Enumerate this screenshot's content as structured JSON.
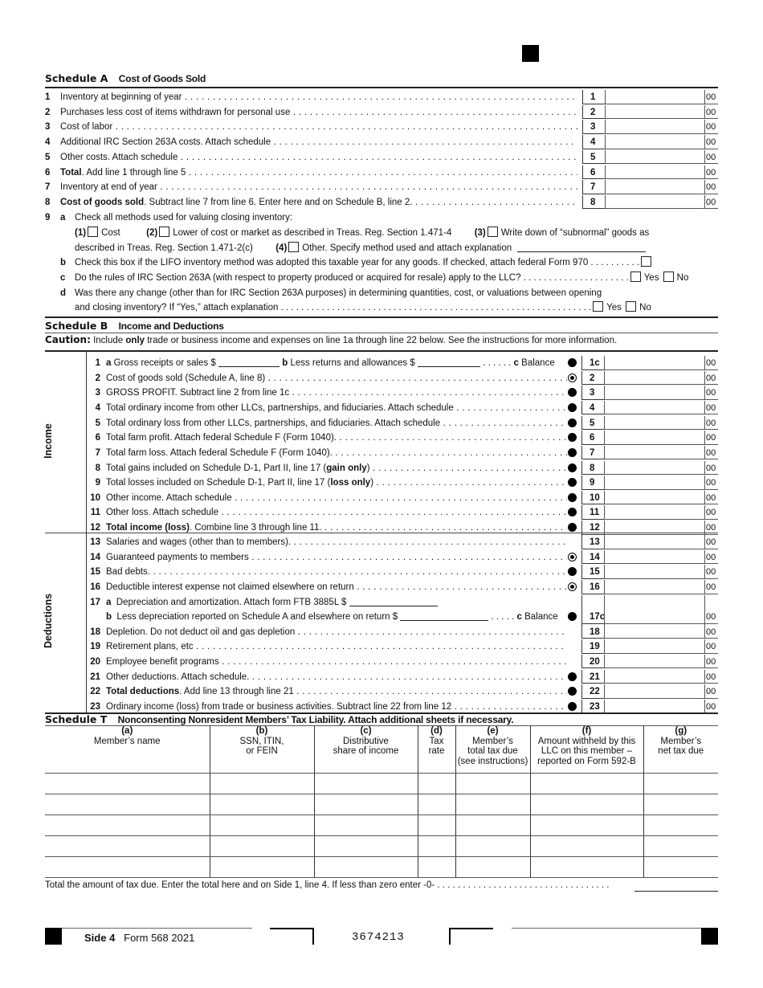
{
  "schedule_a": {
    "code": "Schedule A",
    "title": "Cost of Goods Sold",
    "lines": [
      {
        "num": "1",
        "desc": "Inventory at beginning of year",
        "box": "1",
        "cents": "00"
      },
      {
        "num": "2",
        "desc": "Purchases less cost of items withdrawn for personal use",
        "box": "2",
        "cents": "00"
      },
      {
        "num": "3",
        "desc": "Cost of labor",
        "box": "3",
        "cents": "00"
      },
      {
        "num": "4",
        "desc": "Additional IRC Section 263A costs. Attach schedule",
        "box": "4",
        "cents": "00"
      },
      {
        "num": "5",
        "desc": "Other costs. Attach schedule",
        "box": "5",
        "cents": "00"
      },
      {
        "num": "6",
        "desc_bold": "Total",
        "desc": ". Add line 1 through line 5",
        "box": "6",
        "cents": "00"
      },
      {
        "num": "7",
        "desc": "Inventory at end of year",
        "box": "7",
        "cents": "00"
      },
      {
        "num": "8",
        "desc_bold": "Cost of goods sold",
        "desc": ". Subtract line 7 from line 6. Enter here and on Schedule B, line 2.",
        "box": "8",
        "cents": "00"
      }
    ],
    "line9": {
      "num": "9",
      "a_letter": "a",
      "a_text": "Check all methods used for valuing closing inventory:",
      "opt1_num": "(1)",
      "opt1_label": "Cost",
      "opt2_num": "(2)",
      "opt2_label": "Lower of cost or market as described in Treas. Reg. Section 1.471-4",
      "opt3_num": "(3)",
      "opt3_label": "Write down of “subnormal” goods as",
      "opt3_cont": "described in Treas. Reg. Section 1.471-2(c)",
      "opt4_num": "(4)",
      "opt4_label": "Other. Specify method used and attach explanation",
      "b_letter": "b",
      "b_text": "Check this box if the LIFO inventory method was adopted this taxable year for any goods. If checked, attach federal Form 970 . . . . . . . . . .",
      "c_letter": "c",
      "c_text": "Do the rules of IRC Section 263A (with respect to property produced or acquired for resale) apply to the LLC? . . . . . . . . . . . . . . . . . . . . .",
      "d_letter": "d",
      "d_text": "Was there any change (other than for IRC Section 263A purposes) in determining quantities, cost, or valuations between opening",
      "d_cont": "and closing inventory? If “Yes,” attach explanation . . . . . . . . . . . . . . . . . . . . . . . . . . . . . . . . . . . . . . . . . . . . . . . . . . . . . . . . . . . . .",
      "yes": "Yes",
      "no": "No"
    }
  },
  "schedule_b": {
    "code": "Schedule B",
    "title": "Income and Deductions",
    "caution_label": "Caution:",
    "caution_pre": "Include",
    "caution_bold": "only",
    "caution_post": "trade or business income and expenses on line 1a through line 22 below. See the instructions for more information.",
    "income_label": "Income",
    "deductions_label": "Deductions",
    "line1": {
      "num": "1",
      "a": "a",
      "a_text": "Gross receipts or sales $",
      "b": "b",
      "b_text": "Less returns and allowances $",
      "dots": ". . . . . .",
      "c": "c",
      "c_text": "Balance",
      "box": "1c",
      "cents": "00"
    },
    "income_lines": [
      {
        "num": "2",
        "desc": "Cost of goods sold (Schedule A, line 8)",
        "box": "2",
        "cents": "00",
        "marker": "ring"
      },
      {
        "num": "3",
        "desc": "GROSS PROFIT. Subtract line 2 from line 1c",
        "box": "3",
        "cents": "00",
        "marker": "dot"
      },
      {
        "num": "4",
        "desc": "Total ordinary income from other LLCs, partnerships, and fiduciaries. Attach schedule",
        "box": "4",
        "cents": "00",
        "marker": "dot"
      },
      {
        "num": "5",
        "desc": "Total ordinary loss from other LLCs, partnerships, and fiduciaries. Attach schedule",
        "box": "5",
        "cents": "00",
        "marker": "dot"
      },
      {
        "num": "6",
        "desc": "Total farm profit. Attach federal Schedule F (Form 1040).",
        "box": "6",
        "cents": "00",
        "marker": "dot"
      },
      {
        "num": "7",
        "desc": "Total farm loss. Attach federal Schedule F (Form 1040).",
        "box": "7",
        "cents": "00",
        "marker": "dot"
      },
      {
        "num": "8",
        "desc": "Total gains included on Schedule D-1, Part II, line 17 (",
        "desc_bold": "gain only",
        "desc_end": ")",
        "box": "8",
        "cents": "00",
        "marker": "dot"
      },
      {
        "num": "9",
        "desc": "Total losses included on Schedule D-1, Part II, line 17 (",
        "desc_bold": "loss only",
        "desc_end": ")",
        "box": "9",
        "cents": "00",
        "marker": "dot"
      },
      {
        "num": "10",
        "desc": "Other income. Attach schedule",
        "box": "10",
        "cents": "00",
        "marker": "dot"
      },
      {
        "num": "11",
        "desc": "Other loss. Attach schedule",
        "box": "11",
        "cents": "00",
        "marker": "dot"
      },
      {
        "num": "12",
        "desc_lead_bold": "Total income (loss)",
        "desc": ". Combine line 3 through line 11.",
        "box": "12",
        "cents": "00",
        "marker": "dot"
      }
    ],
    "deduction_lines_a": [
      {
        "num": "13",
        "desc": "Salaries and wages (other than to members).",
        "box": "13",
        "cents": "00",
        "marker": "none"
      },
      {
        "num": "14",
        "desc": "Guaranteed payments to members",
        "box": "14",
        "cents": "00",
        "marker": "ring"
      },
      {
        "num": "15",
        "desc": "Bad debts.",
        "box": "15",
        "cents": "00",
        "marker": "dot"
      },
      {
        "num": "16",
        "desc": "Deductible interest expense not claimed elsewhere on return",
        "box": "16",
        "cents": "00",
        "marker": "ring"
      }
    ],
    "line17": {
      "num": "17",
      "a": "a",
      "a_text": "Depreciation and amortization. Attach form FTB 3885L $",
      "b": "b",
      "b_text": "Less depreciation reported on Schedule A and elsewhere on return $",
      "dots": ". . . . .",
      "c": "c",
      "c_text": "Balance",
      "box": "17c",
      "cents": "00"
    },
    "deduction_lines_b": [
      {
        "num": "18",
        "desc": "Depletion. Do not deduct oil and gas depletion",
        "box": "18",
        "cents": "00",
        "marker": "none"
      },
      {
        "num": "19",
        "desc": "Retirement plans, etc",
        "box": "19",
        "cents": "00",
        "marker": "none"
      },
      {
        "num": "20",
        "desc": "Employee benefit programs",
        "box": "20",
        "cents": "00",
        "marker": "none"
      },
      {
        "num": "21",
        "desc": "Other deductions. Attach schedule.",
        "box": "21",
        "cents": "00",
        "marker": "dot"
      },
      {
        "num": "22",
        "desc_lead_bold": "Total deductions",
        "desc": ". Add line 13 through line 21",
        "box": "22",
        "cents": "00",
        "marker": "dot"
      },
      {
        "num": "23",
        "desc": "Ordinary income (loss) from trade or business activities. Subtract line 22 from line 12",
        "box": "23",
        "cents": "00",
        "marker": "dot"
      }
    ]
  },
  "schedule_t": {
    "code": "Schedule T",
    "title": "Nonconsenting Nonresident Members’ Tax Liability. Attach additional sheets if necessary.",
    "columns": [
      {
        "letter": "(a)",
        "label": "Member’s name"
      },
      {
        "letter": "(b)",
        "label": "SSN, ITIN,\nor FEIN"
      },
      {
        "letter": "(c)",
        "label": "Distributive\nshare of income"
      },
      {
        "letter": "(d)",
        "label": "Tax\nrate"
      },
      {
        "letter": "(e)",
        "label": "Member’s\ntotal tax due\n(see instructions)"
      },
      {
        "letter": "(f)",
        "label": "Amount withheld by this\nLLC on this member –\nreported on Form 592-B"
      },
      {
        "letter": "(g)",
        "label": "Member’s\nnet tax due"
      }
    ],
    "rows": [
      [
        "",
        "",
        "",
        "",
        "",
        "",
        ""
      ],
      [
        "",
        "",
        "",
        "",
        "",
        "",
        ""
      ],
      [
        "",
        "",
        "",
        "",
        "",
        "",
        ""
      ],
      [
        "",
        "",
        "",
        "",
        "",
        "",
        ""
      ],
      [
        "",
        "",
        "",
        "",
        "",
        "",
        ""
      ]
    ],
    "total_text": "Total the amount of tax due. Enter the total here and on Side 1, line 4. If less than zero enter -0- . . . . . . . . . . . . . . . . . . . . . . . . . . . . . . . . . ."
  },
  "footer": {
    "side": "Side 4",
    "form": "Form 568  2021",
    "code": "3674213"
  }
}
